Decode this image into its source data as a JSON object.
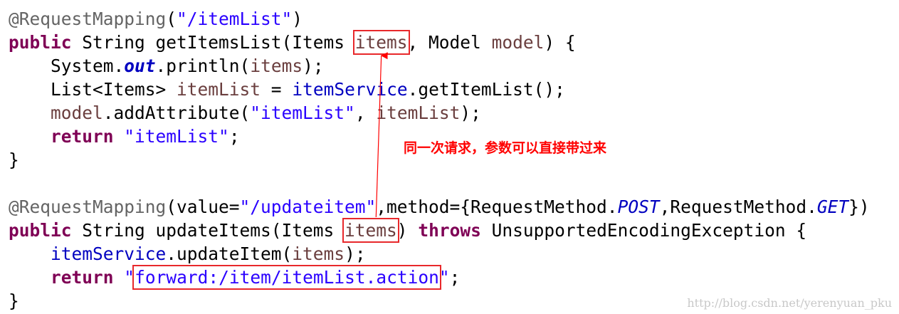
{
  "code": {
    "l1": {
      "ann": "@RequestMapping",
      "p1": "(",
      "str": "\"/itemList\"",
      "p2": ")"
    },
    "l2": {
      "kw": "public",
      "t1": " String getItemsList(Items ",
      "param": "items",
      "t2": ", Model ",
      "param2": "model",
      "t3": ") {"
    },
    "l3": {
      "indent": "    ",
      "t1": "System.",
      "sf": "out",
      "t2": ".println(",
      "v": "items",
      "t3": ");"
    },
    "l4": {
      "indent": "    ",
      "t1": "List<Items> ",
      "v": "itemList",
      "t2": " = ",
      "f": "itemService",
      "t3": ".getItemList();"
    },
    "l5": {
      "indent": "    ",
      "v": "model",
      "t1": ".addAttribute(",
      "s": "\"itemList\"",
      "t2": ", ",
      "v2": "itemList",
      "t3": ");"
    },
    "l6": {
      "indent": "    ",
      "kw": "return",
      "t1": " ",
      "s": "\"itemList\"",
      "t2": ";"
    },
    "l7": {
      "t1": "}"
    },
    "l9": {
      "ann": "@RequestMapping",
      "t1": "(value=",
      "s": "\"/updateitem\"",
      "t2": ",method={RequestMethod.",
      "e1": "POST",
      "t3": ",RequestMethod.",
      "e2": "GET",
      "t4": "})"
    },
    "l10": {
      "kw": "public",
      "t1": " String updateItems(Items ",
      "param": "items",
      "t2": ") ",
      "kw2": "throws",
      "t3": " UnsupportedEncodingException {"
    },
    "l11": {
      "indent": "    ",
      "f": "itemService",
      "t1": ".updateItem(",
      "v": "items",
      "t2": ");"
    },
    "l12": {
      "indent": "    ",
      "kw": "return",
      "t1": " ",
      "q1": "\"",
      "s": "forward:/item/itemList.action",
      "q2": "\"",
      "t2": ";"
    },
    "l13": {
      "t1": "}"
    }
  },
  "annotation_text": "同一次请求，参数可以直接带过来",
  "watermark": "http://blog.csdn.net/yerenyuan_pku",
  "colors": {
    "keyword": "#7f0055",
    "string": "#2a00ff",
    "annotation": "#646464",
    "local_variable": "#6a3e3e",
    "field": "#0000c0",
    "highlight_box": "#e8282b",
    "note": "#ff0000"
  }
}
